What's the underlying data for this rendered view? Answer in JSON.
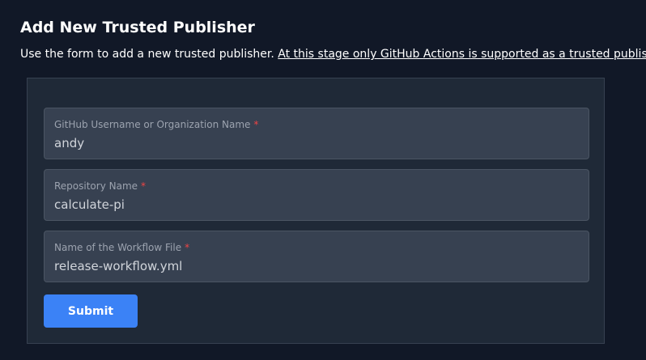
{
  "header": {
    "title": "Add New Trusted Publisher",
    "description": "Use the form to add a new trusted publisher.",
    "notice_link": "At this stage only GitHub Actions is supported as a trusted publisher."
  },
  "form": {
    "fields": [
      {
        "label": "GitHub Username or Organization Name",
        "required_mark": "*",
        "value": "andy"
      },
      {
        "label": "Repository Name",
        "required_mark": "*",
        "value": "calculate-pi"
      },
      {
        "label": "Name of the Workflow File",
        "required_mark": "*",
        "value": "release-workflow.yml"
      }
    ],
    "submit_label": "Submit"
  },
  "colors": {
    "page_background": "#111827",
    "panel_background": "#1f2937",
    "field_background": "#374151",
    "required_mark": "#ef4444",
    "primary_button": "#3b82f6"
  }
}
